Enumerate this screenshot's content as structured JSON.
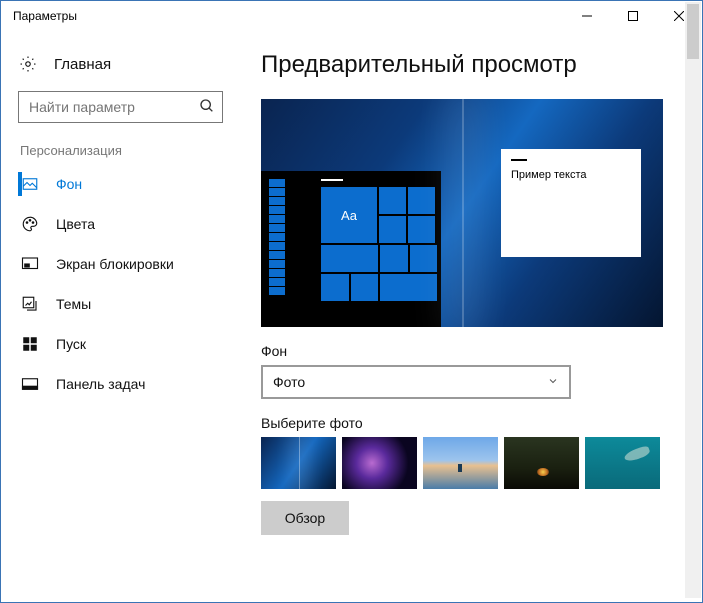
{
  "window": {
    "title": "Параметры"
  },
  "sidebar": {
    "home": "Главная",
    "search_placeholder": "Найти параметр",
    "category": "Персонализация",
    "items": [
      {
        "label": "Фон",
        "icon": "picture-icon",
        "active": true
      },
      {
        "label": "Цвета",
        "icon": "palette-icon",
        "active": false
      },
      {
        "label": "Экран блокировки",
        "icon": "lock-screen-icon",
        "active": false
      },
      {
        "label": "Темы",
        "icon": "themes-icon",
        "active": false
      },
      {
        "label": "Пуск",
        "icon": "start-icon",
        "active": false
      },
      {
        "label": "Панель задач",
        "icon": "taskbar-icon",
        "active": false
      }
    ]
  },
  "main": {
    "heading": "Предварительный просмотр",
    "preview": {
      "tile_text": "Aa",
      "sample_text": "Пример текста"
    },
    "bg_label": "Фон",
    "bg_select_value": "Фото",
    "choose_label": "Выберите фото",
    "browse": "Обзор"
  }
}
